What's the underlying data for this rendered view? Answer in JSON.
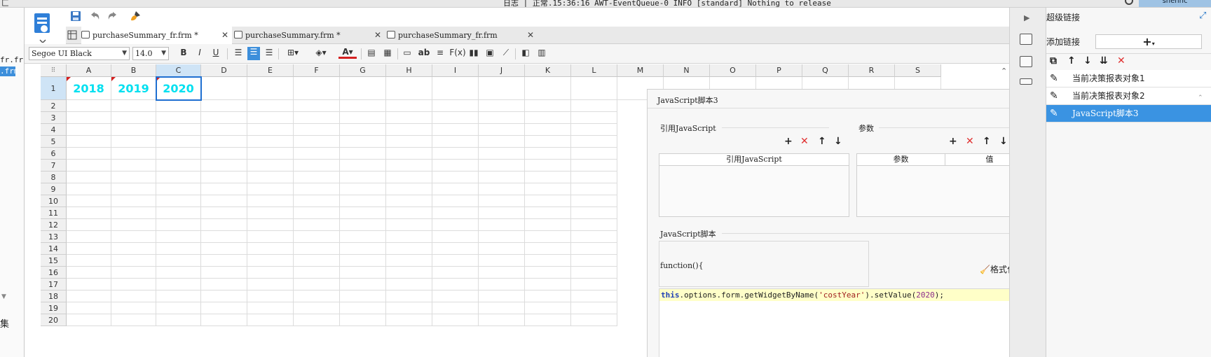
{
  "status": {
    "left_label": "匚",
    "log_text": "日志 | 正常.15:36:16 AWT-EventQueue-0 INFO [standard] Nothing to release",
    "user": "shenhc"
  },
  "left_panel": {
    "item1": "fr.fr",
    "item2": ".frm",
    "bottom": "集"
  },
  "tabs": [
    {
      "label": "purchaseSummary_fr.frm *"
    },
    {
      "label": "purchaseSummary.frm *"
    },
    {
      "label": "purchaseSummary_fr.frm"
    }
  ],
  "format": {
    "font": "Segoe UI Black",
    "size": "14.0",
    "bold": "B",
    "italic": "I",
    "underline": "U",
    "text_a": "A",
    "ab": "ab",
    "fx": "F(x)"
  },
  "grid": {
    "columns": [
      "A",
      "B",
      "C",
      "D",
      "E",
      "F",
      "G",
      "H",
      "I",
      "J",
      "K",
      "L",
      "M",
      "N",
      "O",
      "P",
      "Q",
      "R",
      "S"
    ],
    "rows": [
      "1",
      "2",
      "3",
      "4",
      "5",
      "6",
      "7",
      "8",
      "9",
      "10",
      "11",
      "12",
      "13",
      "14",
      "15",
      "16",
      "17",
      "18",
      "19",
      "20"
    ],
    "cells": {
      "A1": "2018",
      "B1": "2019",
      "C1": "2020"
    },
    "selected_cell": "C1",
    "cell_color": "#00e0f0"
  },
  "dialog": {
    "title": "JavaScript脚本3",
    "ref_js_label": "引用JavaScript",
    "params_label": "参数",
    "ref_js_col": "引用JavaScript",
    "param_col": "参数",
    "value_col": "值",
    "script_label": "JavaScript脚本",
    "func_sig": "function(){",
    "format_code": "格式化代码",
    "code": {
      "this": "this",
      "mid": ".options.form.getWidgetByName(",
      "arg": "'costYear'",
      "mid2": ").setValue(",
      "num": "2020",
      "end": ");"
    }
  },
  "hyperlink_panel": {
    "title": "超级链接",
    "add_label": "添加链接",
    "items": [
      {
        "label": "当前决策报表对象1"
      },
      {
        "label": "当前决策报表对象2"
      },
      {
        "label": "JavaScript脚本3"
      }
    ],
    "selected_index": 2,
    "accent": "#3a93e2"
  }
}
